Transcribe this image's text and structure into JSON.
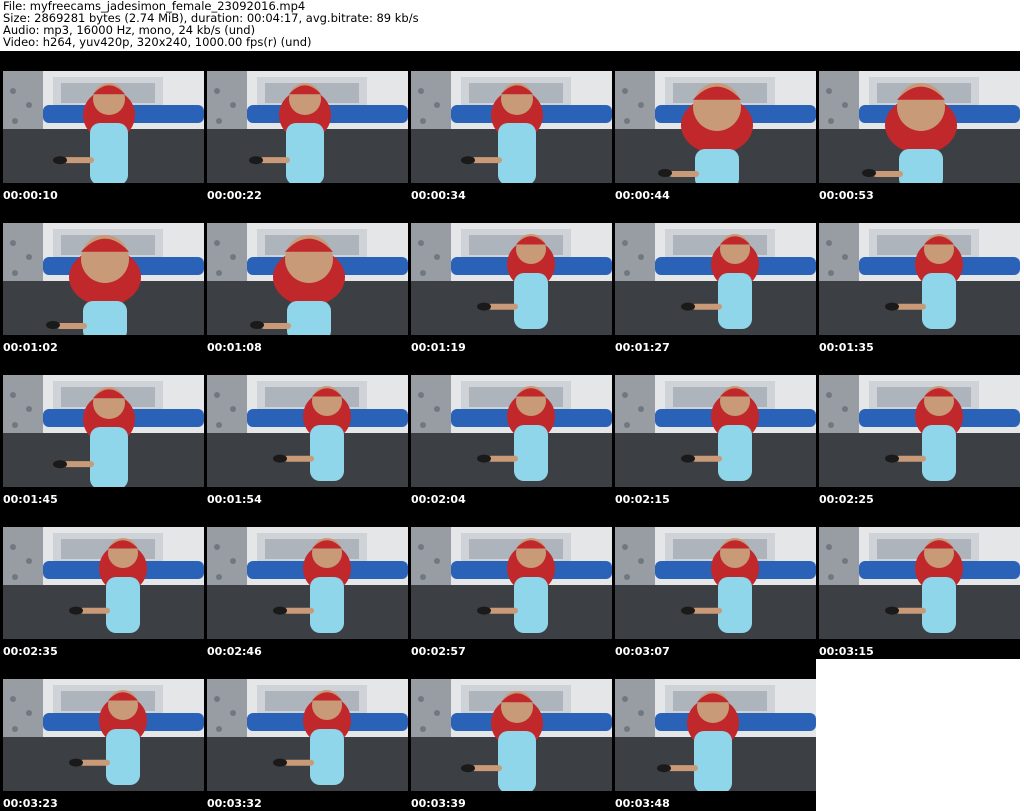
{
  "header": {
    "file": "File: myfreecams_jadesimon_female_23092016.mp4",
    "size": "Size: 2869281 bytes (2.74 MiB), duration: 00:04:17, avg.bitrate: 89 kb/s",
    "audio": "Audio: mp3, 16000 Hz, mono, 24 kb/s (und)",
    "video": "Video: h264, yuv420p, 320x240, 1000.00 fps(r) (und)"
  },
  "colors": {
    "hair": "#c0282c",
    "top": "#8fd6ea",
    "skin": "#c99a78",
    "wall": "#e4e6e8",
    "bed": "#3c3f44",
    "pillow": "#2a62b8",
    "curtain": "#8a8f96"
  },
  "thumbnails": [
    {
      "time": "00:00:10",
      "pose": "close"
    },
    {
      "time": "00:00:22",
      "pose": "close"
    },
    {
      "time": "00:00:34",
      "pose": "close"
    },
    {
      "time": "00:00:44",
      "pose": "lean"
    },
    {
      "time": "00:00:53",
      "pose": "lean"
    },
    {
      "time": "00:01:02",
      "pose": "lean"
    },
    {
      "time": "00:01:08",
      "pose": "lean"
    },
    {
      "time": "00:01:19",
      "pose": "sit"
    },
    {
      "time": "00:01:27",
      "pose": "sit"
    },
    {
      "time": "00:01:35",
      "pose": "sit"
    },
    {
      "time": "00:01:45",
      "pose": "close"
    },
    {
      "time": "00:01:54",
      "pose": "sit"
    },
    {
      "time": "00:02:04",
      "pose": "sit"
    },
    {
      "time": "00:02:15",
      "pose": "sit"
    },
    {
      "time": "00:02:25",
      "pose": "sit"
    },
    {
      "time": "00:02:35",
      "pose": "sit"
    },
    {
      "time": "00:02:46",
      "pose": "sit"
    },
    {
      "time": "00:02:57",
      "pose": "sit"
    },
    {
      "time": "00:03:07",
      "pose": "sit"
    },
    {
      "time": "00:03:15",
      "pose": "sit"
    },
    {
      "time": "00:03:23",
      "pose": "sit"
    },
    {
      "time": "00:03:32",
      "pose": "sit"
    },
    {
      "time": "00:03:39",
      "pose": "close"
    },
    {
      "time": "00:03:48",
      "pose": "close"
    }
  ]
}
